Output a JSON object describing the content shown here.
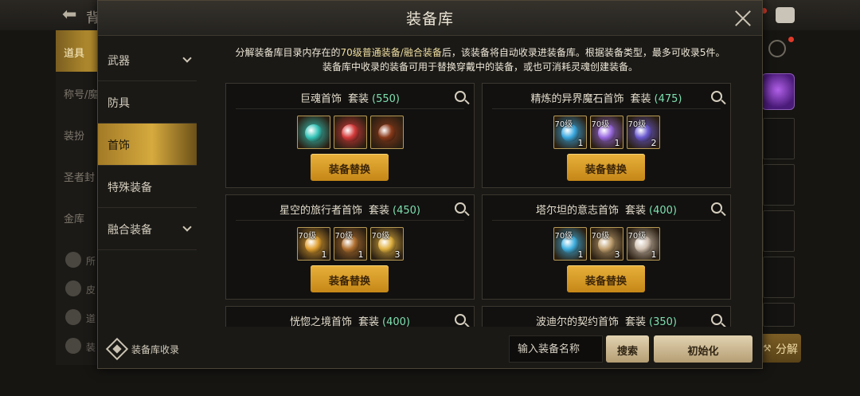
{
  "background": {
    "title": "背",
    "sidebar": [
      "道具",
      "称号/魔",
      "装扮",
      "圣者封",
      "金库"
    ],
    "sidebar_small": [
      "所",
      "皮",
      "道",
      "装"
    ],
    "decompose_label": "分解"
  },
  "dialog": {
    "title": "装备库",
    "categories": [
      {
        "label": "武器",
        "expandable": true
      },
      {
        "label": "防具",
        "expandable": false
      },
      {
        "label": "首饰",
        "expandable": false,
        "selected": true
      },
      {
        "label": "特殊装备",
        "expandable": false
      },
      {
        "label": "融合装备",
        "expandable": true
      }
    ],
    "collect_label": "装备库收录",
    "notice": {
      "line1_a": "分解装备库目录内存在的",
      "line1_b": "70级普通装备/融合装备",
      "line1_c": "后，该装备将自动收录进装备库。根据装备类型，最多可收录5件。",
      "line2": "装备库中收录的装备可用于替换穿戴中的装备，或也可消耗灵魂创建装备。"
    },
    "swap_label": "装备替换",
    "sets": [
      {
        "name": "巨魂首饰",
        "tag": "套装",
        "count": "(550)",
        "items": [
          {
            "level": "",
            "qty": "",
            "color": "#35c3b8"
          },
          {
            "level": "",
            "qty": "",
            "color": "#d43a3a"
          },
          {
            "level": "",
            "qty": "",
            "color": "#8a3a1a"
          }
        ]
      },
      {
        "name": "精炼的异界魔石首饰",
        "tag": "套装",
        "count": "(475)",
        "items": [
          {
            "level": "70级",
            "qty": "1",
            "color": "#3aa8e0"
          },
          {
            "level": "70级",
            "qty": "1",
            "color": "#9a6ae0"
          },
          {
            "level": "70级",
            "qty": "2",
            "color": "#6a5ad0"
          }
        ]
      },
      {
        "name": "星空的旅行者首饰",
        "tag": "套装",
        "count": "(450)",
        "items": [
          {
            "level": "70级",
            "qty": "1",
            "color": "#e0a030"
          },
          {
            "level": "70级",
            "qty": "1",
            "color": "#b07030"
          },
          {
            "level": "70级",
            "qty": "3",
            "color": "#e0b040"
          }
        ]
      },
      {
        "name": "塔尔坦的意志首饰",
        "tag": "套装",
        "count": "(400)",
        "items": [
          {
            "level": "70级",
            "qty": "1",
            "color": "#40b0e0"
          },
          {
            "level": "70级",
            "qty": "3",
            "color": "#c0a070"
          },
          {
            "level": "70级",
            "qty": "1",
            "color": "#d0c0b0"
          }
        ]
      },
      {
        "name": "恍惚之境首饰",
        "tag": "套装",
        "count": "(400)",
        "items": []
      },
      {
        "name": "波迪尔的契约首饰",
        "tag": "套装",
        "count": "(350)",
        "items": []
      }
    ],
    "search": {
      "placeholder": "输入装备名称",
      "button": "搜索"
    },
    "reset_label": "初始化"
  }
}
